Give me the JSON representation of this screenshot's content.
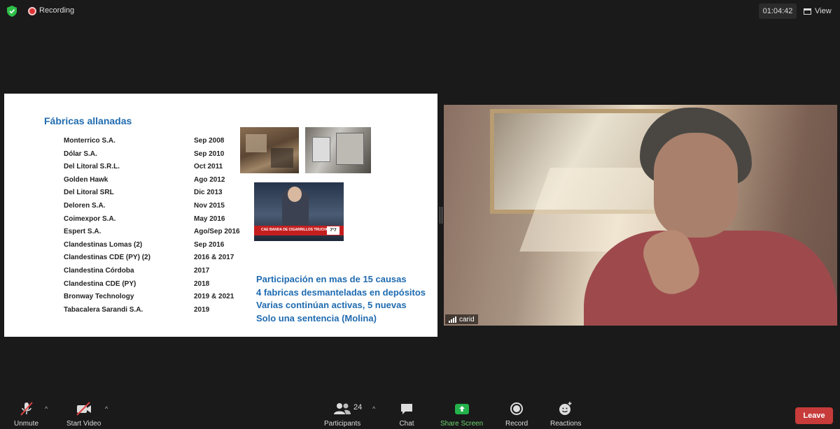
{
  "topbar": {
    "recording_label": "Recording",
    "timer": "01:04:42",
    "view_label": "View"
  },
  "slide": {
    "title": "Fábricas  allanadas",
    "rows": [
      {
        "name": "Monterrico S.A.",
        "date": "Sep 2008"
      },
      {
        "name": "Dólar S.A.",
        "date": "Sep 2010"
      },
      {
        "name": "Del Litoral S.R.L.",
        "date": "Oct 2011"
      },
      {
        "name": "Golden Hawk",
        "date": "Ago 2012"
      },
      {
        "name": "Del Litoral SRL",
        "date": "Dic 2013"
      },
      {
        "name": "Deloren S.A.",
        "date": "Nov 2015"
      },
      {
        "name": "Coimexpor S.A.",
        "date": "May 2016"
      },
      {
        "name": "Espert S.A.",
        "date": "Ago/Sep 2016"
      },
      {
        "name": "Clandestinas Lomas (2)",
        "date": "Sep 2016"
      },
      {
        "name": "Clandestinas CDE (PY) (2)",
        "date": "2016 & 2017"
      },
      {
        "name": "Clandestina Córdoba",
        "date": "2017"
      },
      {
        "name": "Clandestina CDE (PY)",
        "date": "2018"
      },
      {
        "name": "Bronway Technology",
        "date": "2019 & 2021"
      },
      {
        "name": "Tabacalera Sarandi S.A.",
        "date": "2019"
      }
    ],
    "news_ticker": "CAE BANDA DE CIGARRILLOS TRUCHOS",
    "news_clock": "7°7",
    "summary_lines": [
      "Participación en mas de 15 causas",
      "4 fabricas desmanteladas en depósitos",
      "Varias continúan activas, 5 nuevas",
      "Solo una sentencia (Molina)"
    ]
  },
  "participant": {
    "name": "carid"
  },
  "toolbar": {
    "unmute_label": "Unmute",
    "start_video_label": "Start Video",
    "participants_label": "Participants",
    "participants_count": "24",
    "chat_label": "Chat",
    "share_screen_label": "Share Screen",
    "record_label": "Record",
    "reactions_label": "Reactions",
    "leave_label": "Leave"
  },
  "colors": {
    "slide_accent": "#1f6bb0",
    "share_green": "#23b24b",
    "leave_red": "#c73b3b"
  }
}
